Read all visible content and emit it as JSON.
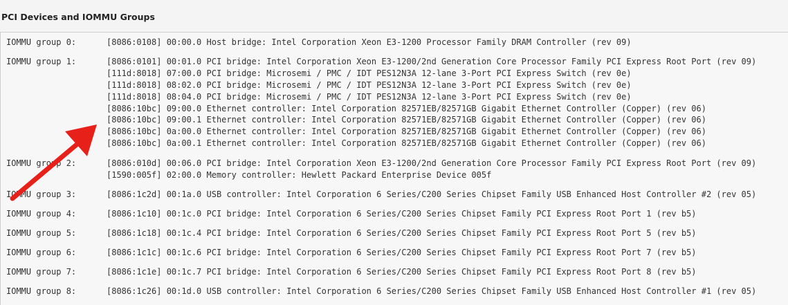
{
  "panel": {
    "title": "PCI Devices and IOMMU Groups"
  },
  "colors": {
    "annotation_arrow": "#e8201a",
    "text": "#333333",
    "output_background": "#f7f7f7"
  },
  "icons": {
    "cursor": "pointer-cursor-icon",
    "annotation": "red-arrow-annotation"
  },
  "groups": [
    {
      "label": "IOMMU group 0:",
      "devices": [
        "[8086:0108] 00:00.0 Host bridge: Intel Corporation Xeon E3-1200 Processor Family DRAM Controller (rev 09)"
      ]
    },
    {
      "label": "IOMMU group 1:",
      "devices": [
        "[8086:0101] 00:01.0 PCI bridge: Intel Corporation Xeon E3-1200/2nd Generation Core Processor Family PCI Express Root Port (rev 09)",
        "[111d:8018] 07:00.0 PCI bridge: Microsemi / PMC / IDT PES12N3A 12-lane 3-Port PCI Express Switch (rev 0e)",
        "[111d:8018] 08:02.0 PCI bridge: Microsemi / PMC / IDT PES12N3A 12-lane 3-Port PCI Express Switch (rev 0e)",
        "[111d:8018] 08:04.0 PCI bridge: Microsemi / PMC / IDT PES12N3A 12-lane 3-Port PCI Express Switch (rev 0e)",
        "[8086:10bc] 09:00.0 Ethernet controller: Intel Corporation 82571EB/82571GB Gigabit Ethernet Controller (Copper) (rev 06)",
        "[8086:10bc] 09:00.1 Ethernet controller: Intel Corporation 82571EB/82571GB Gigabit Ethernet Controller (Copper) (rev 06)",
        "[8086:10bc] 0a:00.0 Ethernet controller: Intel Corporation 82571EB/82571GB Gigabit Ethernet Controller (Copper) (rev 06)",
        "[8086:10bc] 0a:00.1 Ethernet controller: Intel Corporation 82571EB/82571GB Gigabit Ethernet Controller (Copper) (rev 06)"
      ]
    },
    {
      "label": "IOMMU group 2:",
      "devices": [
        "[8086:010d] 00:06.0 PCI bridge: Intel Corporation Xeon E3-1200/2nd Generation Core Processor Family PCI Express Root Port (rev 09)",
        "[1590:005f] 02:00.0 Memory controller: Hewlett Packard Enterprise Device 005f"
      ]
    },
    {
      "label": "IOMMU group 3:",
      "devices": [
        "[8086:1c2d] 00:1a.0 USB controller: Intel Corporation 6 Series/C200 Series Chipset Family USB Enhanced Host Controller #2 (rev 05)"
      ]
    },
    {
      "label": "IOMMU group 4:",
      "devices": [
        "[8086:1c10] 00:1c.0 PCI bridge: Intel Corporation 6 Series/C200 Series Chipset Family PCI Express Root Port 1 (rev b5)"
      ]
    },
    {
      "label": "IOMMU group 5:",
      "devices": [
        "[8086:1c18] 00:1c.4 PCI bridge: Intel Corporation 6 Series/C200 Series Chipset Family PCI Express Root Port 5 (rev b5)"
      ]
    },
    {
      "label": "IOMMU group 6:",
      "devices": [
        "[8086:1c1c] 00:1c.6 PCI bridge: Intel Corporation 6 Series/C200 Series Chipset Family PCI Express Root Port 7 (rev b5)"
      ]
    },
    {
      "label": "IOMMU group 7:",
      "devices": [
        "[8086:1c1e] 00:1c.7 PCI bridge: Intel Corporation 6 Series/C200 Series Chipset Family PCI Express Root Port 8 (rev b5)"
      ]
    },
    {
      "label": "IOMMU group 8:",
      "devices": [
        "[8086:1c26] 00:1d.0 USB controller: Intel Corporation 6 Series/C200 Series Chipset Family USB Enhanced Host Controller #1 (rev 05)"
      ]
    }
  ]
}
